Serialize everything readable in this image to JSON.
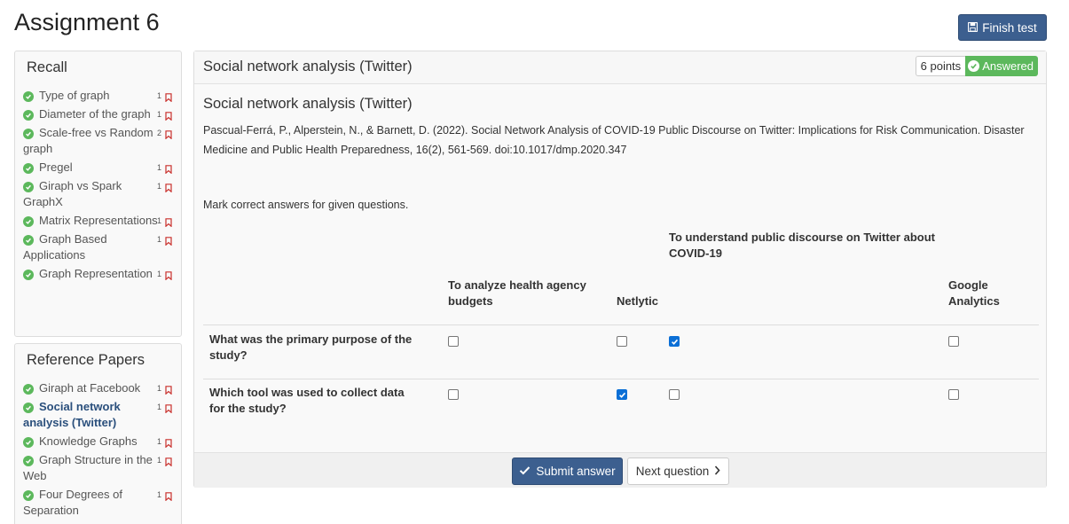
{
  "page": {
    "title": "Assignment 6",
    "finish_label": "Finish test"
  },
  "recall": {
    "heading": "Recall",
    "items": [
      {
        "label": "Type of graph",
        "count": "1"
      },
      {
        "label": "Diameter of the graph",
        "count": "1"
      },
      {
        "label": "Scale-free vs Random graph",
        "count": "2"
      },
      {
        "label": "Pregel",
        "count": "1"
      },
      {
        "label": "Giraph vs Spark GraphX",
        "count": "1"
      },
      {
        "label": "Matrix Representations",
        "count": "1"
      },
      {
        "label": "Graph Based Applications",
        "count": "1"
      },
      {
        "label": "Graph Representation",
        "count": "1"
      }
    ]
  },
  "refs": {
    "heading": "Reference Papers",
    "items": [
      {
        "label": "Giraph at Facebook",
        "count": "1"
      },
      {
        "label": "Social network analysis (Twitter)",
        "count": "1",
        "active": true
      },
      {
        "label": "Knowledge Graphs",
        "count": "1"
      },
      {
        "label": "Graph Structure in the Web",
        "count": "1"
      },
      {
        "label": "Four Degrees of Separation",
        "count": "1"
      }
    ]
  },
  "question": {
    "header": "Social network analysis (Twitter)",
    "points": "6 points",
    "status": "Answered",
    "title": "Social network analysis (Twitter)",
    "citation": "Pascual-Ferrá, P., Alperstein, N., & Barnett, D. (2022). Social Network Analysis of COVID-19 Public Discourse on Twitter: Implications for Risk Communication. Disaster Medicine and Public Health Preparedness, 16(2), 561-569. doi:10.1017/dmp.2020.347",
    "instruction": "Mark correct answers for given questions.",
    "columns": [
      "To analyze health agency budgets",
      "Netlytic",
      "To understand public discourse on Twitter about COVID-19",
      "Google Analytics"
    ],
    "rows": [
      {
        "text": "What was the primary purpose of the study?",
        "checked": [
          false,
          false,
          true,
          false
        ]
      },
      {
        "text": "Which tool was used to collect data for the study?",
        "checked": [
          false,
          true,
          false,
          false
        ]
      }
    ],
    "submit_label": "Submit answer",
    "next_label": "Next question"
  },
  "colors": {
    "primary": "#3c5f8f",
    "success": "#5cb85c",
    "flag": "#c9302c",
    "checkbox": "#0b6fd6"
  }
}
